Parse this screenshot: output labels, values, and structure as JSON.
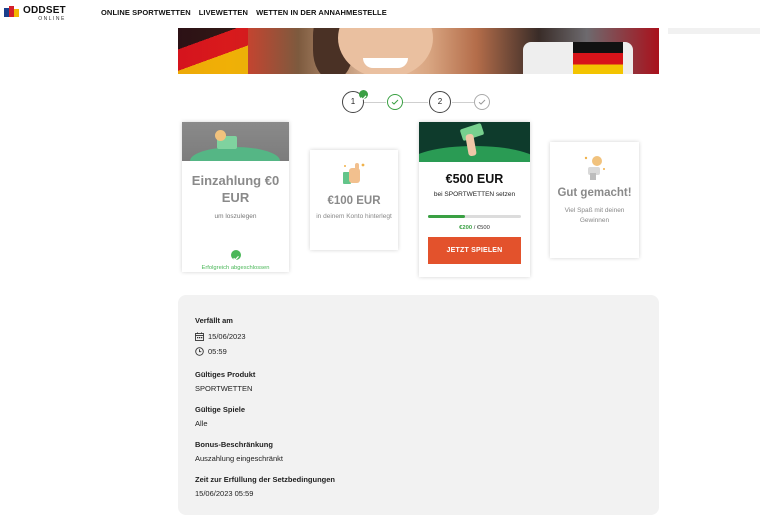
{
  "header": {
    "logo_main": "ODDSET",
    "logo_sub": "ONLINE",
    "nav": [
      "ONLINE SPORTWETTEN",
      "LIVEWETTEN",
      "WETTEN IN DER ANNAHMESTELLE"
    ]
  },
  "steps": {
    "first": "1",
    "third": "2"
  },
  "cards": [
    {
      "title": "Einzahlung €0 EUR",
      "subtitle": "um loszulegen",
      "status": "Erfolgreich abgeschlossen"
    },
    {
      "title": "€100 EUR",
      "subtitle": "in deinem Konto hinterlegt"
    },
    {
      "title": "€500 EUR",
      "subtitle": "bei SPORTWETTEN setzen",
      "progress_current": "€200",
      "progress_total": "/ €500",
      "progress_fraction": 0.4,
      "button": "JETZT SPIELEN"
    },
    {
      "title": "Gut gemacht!",
      "subtitle": "Viel Spaß mit deinen Gewinnen"
    }
  ],
  "details": {
    "expires_label": "Verfällt am",
    "expires_date": "15/06/2023",
    "expires_time": "05:59",
    "product_label": "Gültiges Produkt",
    "product_value": "SPORTWETTEN",
    "games_label": "Gültige Spiele",
    "games_value": "Alle",
    "limit_label": "Bonus-Beschränkung",
    "limit_value": "Auszahlung eingeschränkt",
    "deadline_label": "Zeit zur Erfüllung der Setzbedingungen",
    "deadline_value": "15/06/2023 05:59"
  },
  "colors": {
    "accent": "#e3522c",
    "success": "#3aa043",
    "dark_green": "#0e3b2c"
  }
}
